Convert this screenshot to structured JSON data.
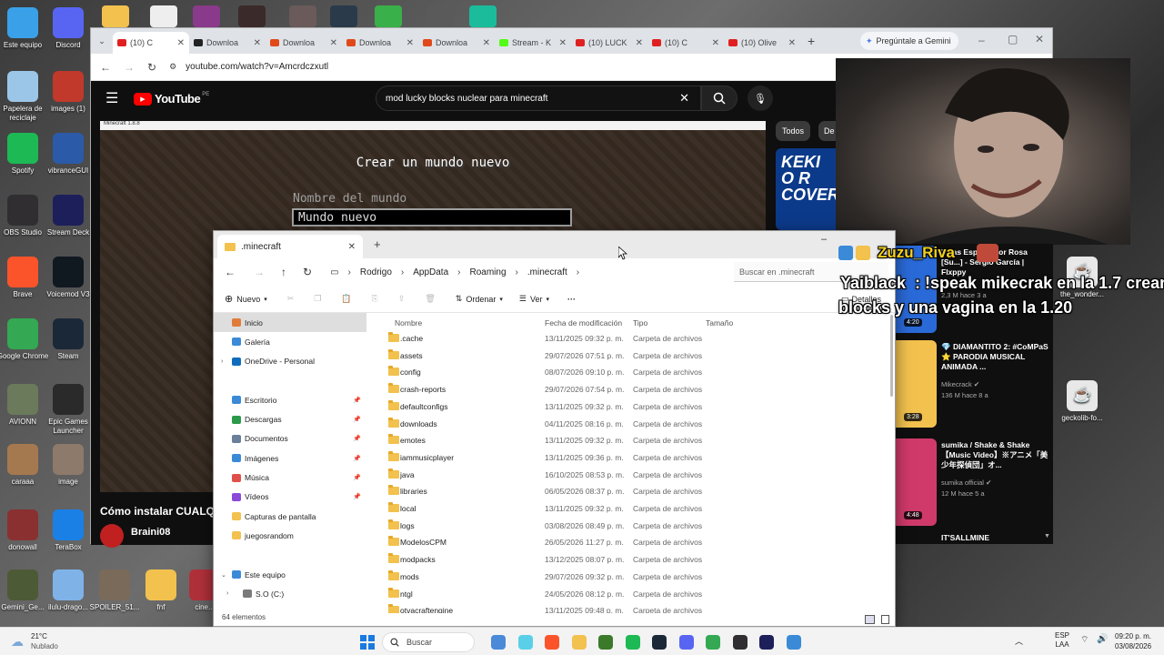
{
  "desktop": {
    "icons_left": [
      {
        "label": "Este equipo",
        "color": "#3aa0e8"
      },
      {
        "label": "Papelera de reciclaje",
        "color": "#9bc6e8"
      },
      {
        "label": "Spotify",
        "color": "#1db954"
      },
      {
        "label": "OBS Studio",
        "color": "#302e31"
      },
      {
        "label": "Brave",
        "color": "#fb542b"
      },
      {
        "label": "Google Chrome",
        "color": "#34a853"
      },
      {
        "label": "AVIONN",
        "color": "#6a7a5a"
      },
      {
        "label": "caraaa",
        "color": "#a5794f"
      },
      {
        "label": "donowall",
        "color": "#8a3030"
      },
      {
        "label": "Gemini_Ge...",
        "color": "#4d5a36"
      }
    ],
    "icons_col2": [
      {
        "label": "Discord",
        "color": "#5865f2"
      },
      {
        "label": "images (1)",
        "color": "#c0392b"
      },
      {
        "label": "vibranceGUI",
        "color": "#2b5aa8"
      },
      {
        "label": "Stream Deck",
        "color": "#1d1f5a"
      },
      {
        "label": "Voicemod V3",
        "color": "#101820"
      },
      {
        "label": "Steam",
        "color": "#1b2838"
      },
      {
        "label": "Epic Games Launcher",
        "color": "#2a2a2a"
      },
      {
        "label": "image",
        "color": "#8e7a6a"
      },
      {
        "label": "TeraBox",
        "color": "#1a80e6"
      },
      {
        "label": "ilulu-drago...",
        "color": "#7fb3e8"
      }
    ],
    "icons_bottom": [
      {
        "label": "SPOILER_51...",
        "color": "#7a6a5a"
      },
      {
        "label": "fnf",
        "color": "#f2c14e"
      },
      {
        "label": "cine...",
        "color": "#b0303a"
      }
    ],
    "icons_right": [
      {
        "label": "the_wonder...",
        "color": "#e8e8e8"
      },
      {
        "label": "geckolib-fo...",
        "color": "#e8e8e8"
      }
    ]
  },
  "browser": {
    "tabs": [
      {
        "title": "(10) C",
        "color": "#e02020"
      },
      {
        "title": "Downloa",
        "color": "#222222"
      },
      {
        "title": "Downloa",
        "color": "#e04a1a"
      },
      {
        "title": "Downloa",
        "color": "#e04a1a"
      },
      {
        "title": "Downloa",
        "color": "#e04a1a"
      },
      {
        "title": "Stream - K",
        "color": "#53fc18"
      },
      {
        "title": "(10) LUCK",
        "color": "#e02020"
      },
      {
        "title": "(10) C",
        "color": "#e02020"
      },
      {
        "title": "(10) Olive",
        "color": "#e02020"
      }
    ],
    "gemini": "Pregúntale a Gemini",
    "url": "youtube.com/watch?v=Amcrdczxutl",
    "youtube": {
      "logo": "YouTube",
      "region": "PE",
      "search_value": "mod lucky blocks nuclear para minecraft",
      "chip_all": "Todos",
      "chip_partial": "De",
      "video_title": "Cómo instalar CUALQ",
      "channel": "Braini08",
      "thumb_text": "KEKI\nO R\nCOVER POR"
    },
    "minecraft": {
      "window_title": "Minecraft 1.8.8",
      "heading": "Crear un mundo nuevo",
      "label": "Nombre del mundo",
      "value": "Mundo nuevo"
    }
  },
  "explorer": {
    "tab_title": ".minecraft",
    "breadcrumb": [
      "Rodrigo",
      "AppData",
      "Roaming",
      ".minecraft"
    ],
    "search_placeholder": "Buscar en .minecraft",
    "cmd": {
      "new": "Nuevo",
      "sort": "Ordenar",
      "view": "Ver",
      "details": "Detalles"
    },
    "sidebar": [
      {
        "label": "Inicio",
        "icon": "home-icon",
        "color": "#e07b39",
        "pin": false
      },
      {
        "label": "Galería",
        "icon": "gallery-icon",
        "color": "#3a8ad8",
        "pin": false
      },
      {
        "label": "OneDrive - Personal",
        "icon": "cloud-icon",
        "color": "#0f6cbd",
        "pin": false
      },
      {
        "label": "",
        "icon": "",
        "color": "",
        "pin": false
      },
      {
        "label": "Escritorio",
        "icon": "desktop-icon",
        "color": "#3a8ad8",
        "pin": true
      },
      {
        "label": "Descargas",
        "icon": "download-icon",
        "color": "#2a9a4a",
        "pin": true
      },
      {
        "label": "Documentos",
        "icon": "document-icon",
        "color": "#6a7f9a",
        "pin": true
      },
      {
        "label": "Imágenes",
        "icon": "image-icon",
        "color": "#3a8ad8",
        "pin": true
      },
      {
        "label": "Música",
        "icon": "music-icon",
        "color": "#e0504a",
        "pin": true
      },
      {
        "label": "Vídeos",
        "icon": "video-icon",
        "color": "#8a4ad8",
        "pin": true
      },
      {
        "label": "Capturas de pantalla",
        "icon": "folder-icon",
        "color": "#f2c14e",
        "pin": false
      },
      {
        "label": "juegosrandom",
        "icon": "folder-icon",
        "color": "#f2c14e",
        "pin": false
      },
      {
        "label": "",
        "icon": "",
        "color": "",
        "pin": false
      },
      {
        "label": "Este equipo",
        "icon": "computer-icon",
        "color": "#3a8ad8",
        "pin": false
      },
      {
        "label": "S.O (C:)",
        "icon": "drive-icon",
        "color": "#7a7a7a",
        "pin": false
      }
    ],
    "columns": {
      "name": "Nombre",
      "date": "Fecha de modificación",
      "type": "Tipo",
      "size": "Tamaño"
    },
    "files": [
      {
        "name": ".cache",
        "date": "13/11/2025 09:32 p. m.",
        "type": "Carpeta de archivos"
      },
      {
        "name": "assets",
        "date": "29/07/2026 07:51 p. m.",
        "type": "Carpeta de archivos"
      },
      {
        "name": "config",
        "date": "08/07/2026 09:10 p. m.",
        "type": "Carpeta de archivos"
      },
      {
        "name": "crash-reports",
        "date": "29/07/2026 07:54 p. m.",
        "type": "Carpeta de archivos"
      },
      {
        "name": "defaultconfigs",
        "date": "13/11/2025 09:32 p. m.",
        "type": "Carpeta de archivos"
      },
      {
        "name": "downloads",
        "date": "04/11/2025 08:16 p. m.",
        "type": "Carpeta de archivos"
      },
      {
        "name": "emotes",
        "date": "13/11/2025 09:32 p. m.",
        "type": "Carpeta de archivos"
      },
      {
        "name": "iammusicplayer",
        "date": "13/11/2025 09:36 p. m.",
        "type": "Carpeta de archivos"
      },
      {
        "name": "java",
        "date": "16/10/2025 08:53 p. m.",
        "type": "Carpeta de archivos"
      },
      {
        "name": "libraries",
        "date": "06/05/2026 08:37 p. m.",
        "type": "Carpeta de archivos"
      },
      {
        "name": "local",
        "date": "13/11/2025 09:32 p. m.",
        "type": "Carpeta de archivos"
      },
      {
        "name": "logs",
        "date": "03/08/2026 08:49 p. m.",
        "type": "Carpeta de archivos"
      },
      {
        "name": "ModelosCPM",
        "date": "26/05/2026 11:27 p. m.",
        "type": "Carpeta de archivos"
      },
      {
        "name": "modpacks",
        "date": "13/12/2025 08:07 p. m.",
        "type": "Carpeta de archivos"
      },
      {
        "name": "mods",
        "date": "29/07/2026 09:32 p. m.",
        "type": "Carpeta de archivos"
      },
      {
        "name": "ntgl",
        "date": "24/05/2026 08:12 p. m.",
        "type": "Carpeta de archivos"
      },
      {
        "name": "otvacraftengine",
        "date": "13/11/2025 09:48 p. m.",
        "type": "Carpeta de archivos"
      }
    ],
    "status": "64 elementos"
  },
  "chat": {
    "user1": "Zuzu_Riva",
    "user2": "Yaiblack",
    "message": ": !speak mikecrak en la 1.7 crean",
    "message2": "blocks y una vagina en la 1.20"
  },
  "related": [
    {
      "title": "Vivas Esp... Color Rosa [Su...] - Sergio García | Flxppy",
      "channel": "",
      "meta": "2,3 M   hace 3 a",
      "duration": "4:20",
      "color": "#2a6ad8"
    },
    {
      "title": "💎 DIAMANTITO 2: #CoMPaS ⭐ PARODIA MUSICAL ANIMADA ...",
      "channel": "Mikecrack ✔",
      "meta": "136 M   hace 8 a",
      "duration": "3:28",
      "color": "#f2c14e"
    },
    {
      "title": "sumika / Shake & Shake【Music Video】※アニメ「美少年探偵団」オ...",
      "channel": "sumika official ✔",
      "meta": "12 M   hace 5 a",
      "duration": "4:48",
      "color": "#d03a6a"
    },
    {
      "title": "IT'SALLMINE",
      "channel": "",
      "meta": "",
      "duration": "",
      "color": "#333333"
    }
  ],
  "taskbar": {
    "weather_temp": "21°C",
    "weather_desc": "Nublado",
    "search": "Buscar",
    "lang": "ESP",
    "lang2": "LAA",
    "time": "09:20 p. m.",
    "date": "03/08/2026",
    "apps": [
      {
        "name": "search-app",
        "color": "#4a8ad8"
      },
      {
        "name": "copilot-icon",
        "color": "#5ad0e8"
      },
      {
        "name": "brave-icon",
        "color": "#fb542b"
      },
      {
        "name": "explorer-icon",
        "color": "#f2c14e"
      },
      {
        "name": "minecraft-icon",
        "color": "#3a7a2a"
      },
      {
        "name": "spotify-icon",
        "color": "#1db954"
      },
      {
        "name": "steam-icon",
        "color": "#1b2838"
      },
      {
        "name": "discord-icon",
        "color": "#5865f2"
      },
      {
        "name": "chrome-icon",
        "color": "#34a853"
      },
      {
        "name": "obs-icon",
        "color": "#302e31"
      },
      {
        "name": "streamdeck-icon",
        "color": "#1d1f5a"
      },
      {
        "name": "vscode-icon",
        "color": "#3a8ad8"
      }
    ]
  }
}
